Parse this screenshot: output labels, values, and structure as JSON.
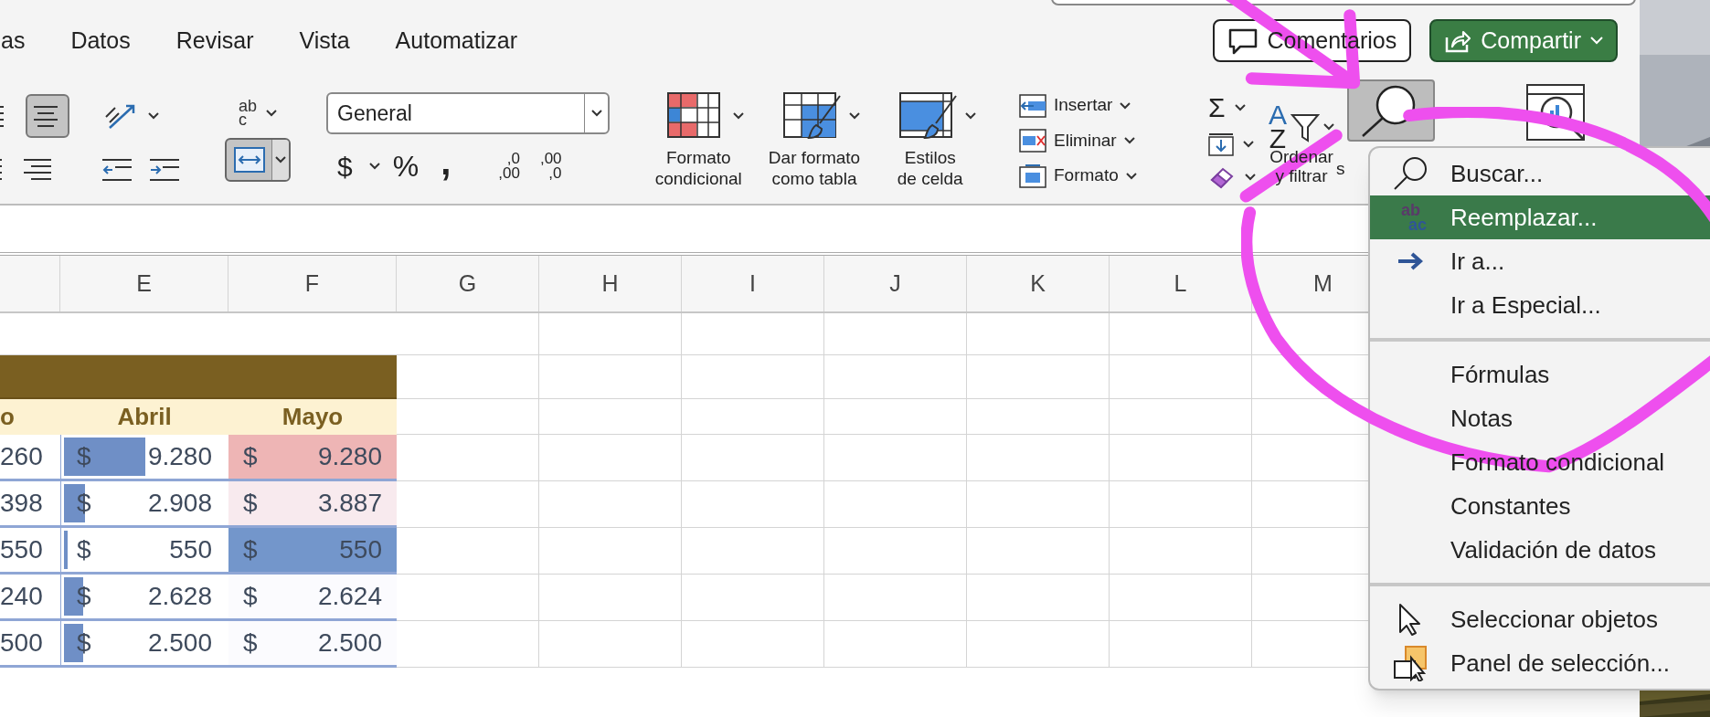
{
  "ribbon_tabs": [
    {
      "label": "as",
      "selected": false
    },
    {
      "label": "Datos",
      "selected": false
    },
    {
      "label": "Revisar",
      "selected": false
    },
    {
      "label": "Vista",
      "selected": false
    },
    {
      "label": "Automatizar",
      "selected": false
    }
  ],
  "comments_button": "Comentarios",
  "share_button": "Compartir",
  "ribbon": {
    "align_middle": {
      "selected": true
    },
    "merge_center": {
      "selected": true
    },
    "wrap_text_icon": [
      "ab",
      "c"
    ],
    "number_format": "General",
    "currency": "$",
    "percent": "%",
    "comma": ",",
    "decimal_buttons": [
      [
        ",0",
        ",00"
      ],
      [
        ",00",
        ",0"
      ]
    ],
    "styles": [
      {
        "kind": "conditional",
        "lines": [
          "Formato",
          "condicional"
        ]
      },
      {
        "kind": "table",
        "lines": [
          "Dar formato",
          "como tabla"
        ]
      },
      {
        "kind": "cell",
        "lines": [
          "Estilos",
          "de celda"
        ]
      }
    ],
    "cells": [
      {
        "kind": "insert",
        "label": "Insertar"
      },
      {
        "kind": "delete",
        "label": "Eliminar"
      },
      {
        "kind": "format",
        "label": "Formato"
      }
    ],
    "autosum": "Σ",
    "sort_filter": {
      "icon_letters": [
        "A",
        "Z"
      ],
      "lines": [
        "Ordenar",
        "y filtrar"
      ]
    },
    "find_select": {
      "selected": true,
      "label": "s"
    }
  },
  "sheet": {
    "columns": [
      "E",
      "F",
      "G",
      "H",
      "I",
      "J",
      "K",
      "L",
      "M"
    ],
    "header_row": [
      "o",
      "Abril",
      "Mayo"
    ],
    "data_rows": [
      {
        "partial": "260",
        "abril": {
          "currency": "$",
          "amount": "9.280",
          "level": 0.5
        },
        "mayo": {
          "currency": "$",
          "amount": "9.280",
          "color": "#eeb5b5"
        }
      },
      {
        "partial": "398",
        "abril": {
          "currency": "$",
          "amount": "2.908",
          "level": 0.13
        },
        "mayo": {
          "currency": "$",
          "amount": "3.887",
          "color": "#f8eaee"
        }
      },
      {
        "partial": "550",
        "abril": {
          "currency": "$",
          "amount": "550",
          "level": 0.02
        },
        "mayo": {
          "currency": "$",
          "amount": "550",
          "color": "#7396cb"
        }
      },
      {
        "partial": "240",
        "abril": {
          "currency": "$",
          "amount": "2.628",
          "level": 0.12
        },
        "mayo": {
          "currency": "$",
          "amount": "2.624",
          "color": "#fbfbfe"
        }
      },
      {
        "partial": "500",
        "abril": {
          "currency": "$",
          "amount": "2.500",
          "level": 0.12
        },
        "mayo": {
          "currency": "$",
          "amount": "2.500",
          "color": "#fbfbfe"
        }
      }
    ]
  },
  "find_menu": [
    {
      "kind": "item",
      "label": "Buscar...",
      "selected": false
    },
    {
      "kind": "item",
      "icon_text": [
        "ab",
        "ac"
      ],
      "label": "Reemplazar...",
      "selected": true
    },
    {
      "kind": "item",
      "label": "Ir a...",
      "selected": false
    },
    {
      "kind": "item",
      "label": "Ir a Especial...",
      "selected": false
    },
    {
      "kind": "separator"
    },
    {
      "kind": "item",
      "label": "Fórmulas",
      "selected": false
    },
    {
      "kind": "item",
      "label": "Notas",
      "selected": false
    },
    {
      "kind": "item",
      "label": "Formato condicional",
      "selected": false
    },
    {
      "kind": "item",
      "label": "Constantes",
      "selected": false
    },
    {
      "kind": "item",
      "label": "Validación de datos",
      "selected": false
    },
    {
      "kind": "separator"
    },
    {
      "kind": "item",
      "label": "Seleccionar objetos",
      "selected": false
    },
    {
      "kind": "item",
      "label": "Panel de selección...",
      "selected": false
    }
  ]
}
